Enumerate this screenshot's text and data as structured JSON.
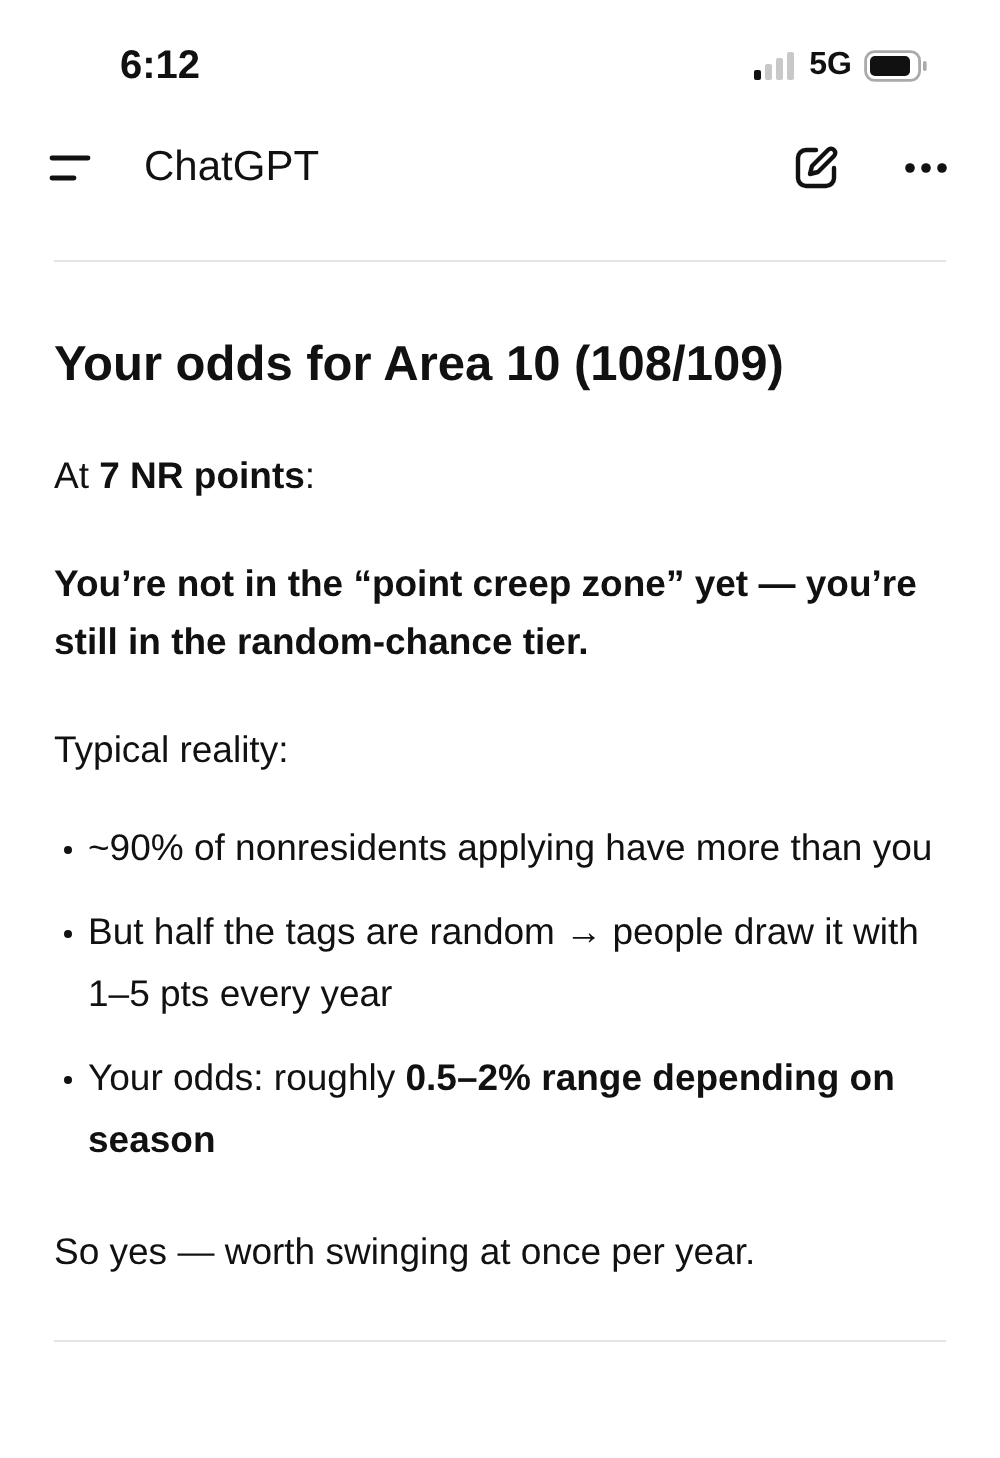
{
  "status_bar": {
    "time": "6:12",
    "network": "5G"
  },
  "header": {
    "title": "ChatGPT"
  },
  "message": {
    "heading": "Your odds for Area 10 (108/109)",
    "paragraphs": [
      {
        "kind": "text",
        "text": "At **7 NR points**:"
      },
      {
        "kind": "strong",
        "text": "You’re not in the “point creep zone” yet — you’re still in the random-chance tier."
      },
      {
        "kind": "text",
        "text": "Typical reality:"
      },
      {
        "kind": "list",
        "items": [
          "~90% of nonresidents applying have more than you",
          "But half the tags are random → people draw it with 1–5 pts every year",
          "Your odds: roughly **0.5–2% range depending on season**"
        ]
      },
      {
        "kind": "text",
        "text": "So yes — worth swinging at once per year."
      }
    ]
  }
}
